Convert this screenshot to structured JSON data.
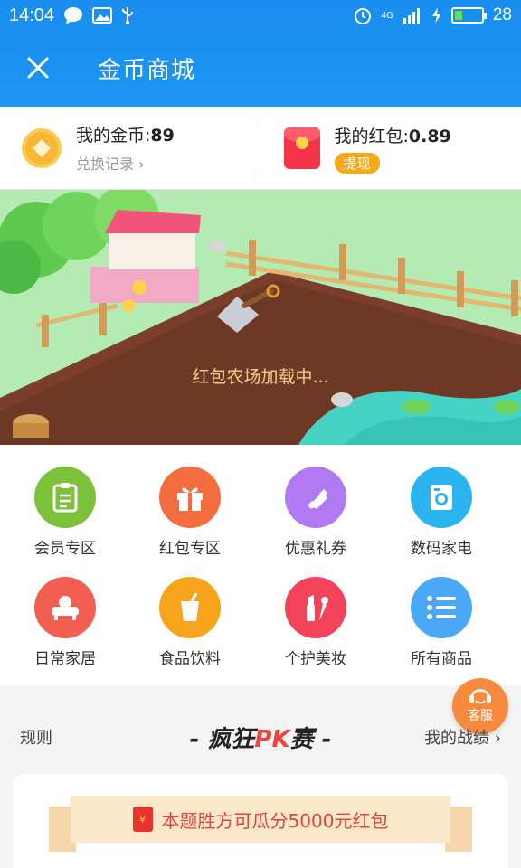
{
  "status_bar": {
    "time": "14:04",
    "network": "4G",
    "battery": "28",
    "battery_level": 0.28
  },
  "header": {
    "title": "金币商城"
  },
  "wallet": {
    "coins_label": "我的金币:",
    "coins_value": "89",
    "exchange_record": "兑换记录",
    "redpacket_label": "我的红包:",
    "redpacket_value": "0.89",
    "withdraw": "提现"
  },
  "farm": {
    "loading_text": "红包农场加载中..."
  },
  "categories": [
    {
      "label": "会员专区",
      "color": "#7cc13a"
    },
    {
      "label": "红包专区",
      "color": "#f46d3f"
    },
    {
      "label": "优惠礼券",
      "color": "#b27af2"
    },
    {
      "label": "数码家电",
      "color": "#2cb4f0"
    },
    {
      "label": "日常家居",
      "color": "#f25e4f"
    },
    {
      "label": "食品饮料",
      "color": "#f7a31c"
    },
    {
      "label": "个护美妆",
      "color": "#f2435b"
    },
    {
      "label": "所有商品",
      "color": "#4aa8f6"
    }
  ],
  "service": {
    "label": "客服"
  },
  "pk": {
    "rules": "规则",
    "title_left": "- 疯狂",
    "title_pk": "PK",
    "title_right": "赛 -",
    "my_record": "我的战绩",
    "banner": "本题胜方可瓜分5000元红包"
  },
  "colors": {
    "primary": "#1a8ef0",
    "accent": "#f7a917",
    "pk_red": "#f0443c"
  }
}
